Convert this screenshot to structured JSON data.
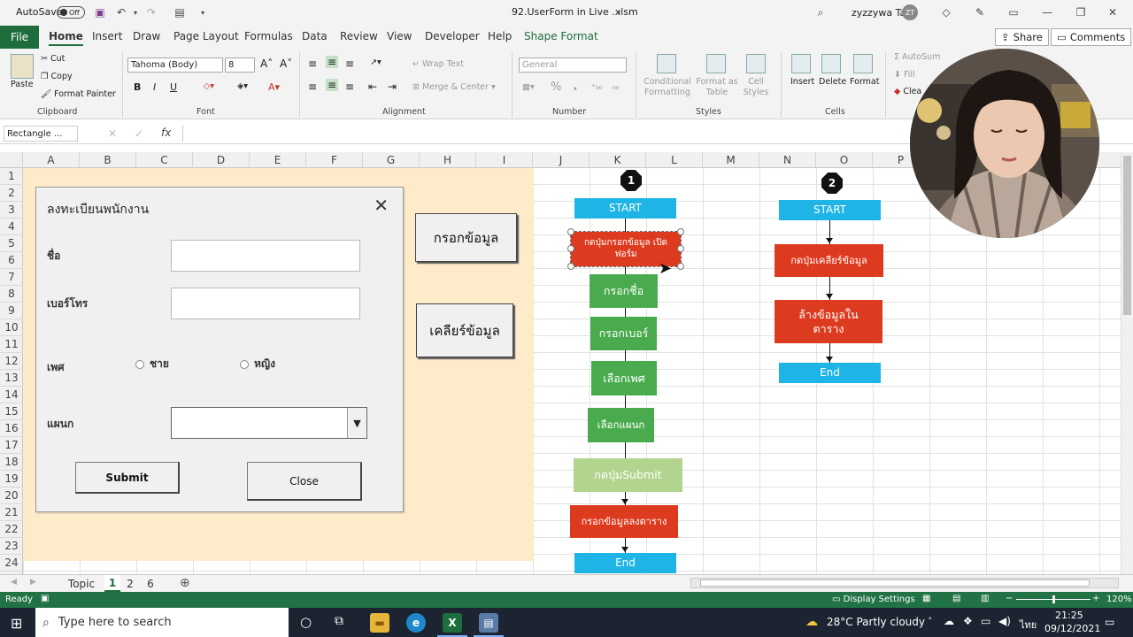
{
  "titlebar": {
    "autosave_label": "AutoSave",
    "autosave_state": "Off",
    "file_name": "92.UserForm in Live .xlsm",
    "user_name": "zyzzywa Ta",
    "user_initials": "ZT"
  },
  "tabs": [
    "File",
    "Home",
    "Insert",
    "Draw",
    "Page Layout",
    "Formulas",
    "Data",
    "Review",
    "View",
    "Developer",
    "Help",
    "Shape Format"
  ],
  "share_label": "Share",
  "comments_label": "Comments",
  "ribbon": {
    "clipboard": {
      "paste": "Paste",
      "cut": "Cut",
      "copy": "Copy",
      "format_painter": "Format Painter",
      "label": "Clipboard"
    },
    "font": {
      "name": "Tahoma (Body)",
      "size": "8",
      "label": "Font",
      "bold": "B",
      "italic": "I",
      "underline": "U"
    },
    "alignment": {
      "wrap": "Wrap Text",
      "merge": "Merge & Center",
      "label": "Alignment"
    },
    "number": {
      "format": "General",
      "percent": "%",
      "label": "Number"
    },
    "styles": {
      "conditional": "Conditional\nFormatting",
      "format_table": "Format as\nTable",
      "cell_styles": "Cell\nStyles",
      "label": "Styles"
    },
    "cells": {
      "insert": "Insert",
      "delete": "Delete",
      "format": "Format",
      "label": "Cells"
    },
    "editing": {
      "autosum": "AutoSum",
      "fill": "Fill",
      "clear": "Clea"
    }
  },
  "formula_bar": {
    "name_box": "Rectangle ...",
    "fx": "fx",
    "value": ""
  },
  "columns": [
    "A",
    "B",
    "C",
    "D",
    "E",
    "F",
    "G",
    "H",
    "I",
    "J",
    "K",
    "L",
    "M",
    "N",
    "O",
    "P"
  ],
  "rows": [
    "1",
    "2",
    "3",
    "4",
    "5",
    "6",
    "7",
    "8",
    "9",
    "10",
    "11",
    "12",
    "13",
    "14",
    "15",
    "16",
    "17",
    "18",
    "19",
    "20",
    "21",
    "22",
    "23",
    "24"
  ],
  "userform": {
    "title": "ลงทะเบียนพนักงาน",
    "close_glyph": "✕",
    "name_label": "ชื่อ",
    "phone_label": "เบอร์โทร",
    "gender_label": "เพศ",
    "male": "ชาย",
    "female": "หญิง",
    "dept_label": "แผนก",
    "submit": "Submit",
    "close": "Close"
  },
  "sheet_buttons": {
    "fill_data": "กรอกข้อมูล",
    "clear_data": "เคลียร์ข้อมูล"
  },
  "flow1": {
    "badge": "1",
    "start": "START",
    "step1": "กดปุ่มกรอกข้อมูล เปิดฟอร์ม",
    "step2": "กรอกชื่อ",
    "step3": "กรอกเบอร์",
    "step4": "เลือกเพศ",
    "step5": "เลือกแผนก",
    "step6": "กดปุ่มSubmit",
    "step7": "กรอกข้อมูลลงตาราง",
    "end": "End"
  },
  "flow2": {
    "badge": "2",
    "start": "START",
    "step1": "กดปุ่มเคลียร์ข้อมูล",
    "step2": "ล้างข้อมูลในตาราง",
    "end": "End"
  },
  "sheet_tabs": [
    "Topic",
    "1",
    "2",
    "6"
  ],
  "active_sheet_tab": "1",
  "status": {
    "ready": "Ready",
    "display_settings": "Display Settings",
    "zoom": "120%"
  },
  "taskbar": {
    "search_placeholder": "Type here to search",
    "weather": "28°C  Partly cloudy",
    "lang": "ไทย",
    "time": "21:25",
    "date": "09/12/2021"
  },
  "colors": {
    "excel_green": "#217346",
    "start_blue": "#1fb4e6",
    "step_red": "#dd3b1f",
    "step_green": "#4aab4e",
    "form_bg": "#fdebc9"
  }
}
